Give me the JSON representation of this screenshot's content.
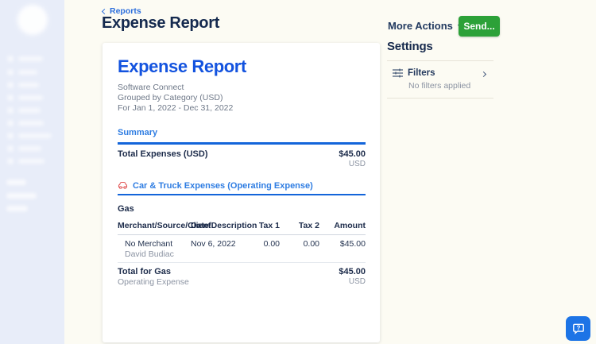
{
  "header": {
    "breadcrumb": "Reports",
    "title": "Expense Report",
    "more_actions_label": "More Actions",
    "send_label": "Send..."
  },
  "report": {
    "title": "Expense Report",
    "company": "Software Connect",
    "grouping": "Grouped by Category (USD)",
    "date_range": "For Jan 1, 2022 - Dec 31, 2022",
    "summary_link": "Summary",
    "total": {
      "label": "Total Expenses (USD)",
      "amount": "$45.00",
      "currency": "USD"
    },
    "category": {
      "icon": "car-icon",
      "label": "Car & Truck Expenses (Operating Expense)"
    },
    "subcategory": "Gas",
    "table": {
      "columns": [
        "Merchant/Source/Client",
        "Date/Description",
        "Tax 1",
        "Tax 2",
        "Amount"
      ],
      "rows": [
        {
          "merchant": "No Merchant",
          "submerchant": "David Budiac",
          "date": "Nov 6, 2022",
          "tax1": "0.00",
          "tax2": "0.00",
          "amount": "$45.00"
        }
      ],
      "total": {
        "label": "Total for Gas",
        "sublabel": "Operating Expense",
        "amount": "$45.00",
        "currency": "USD"
      }
    }
  },
  "settings": {
    "title": "Settings",
    "filters": {
      "label": "Filters",
      "status": "No filters applied"
    }
  },
  "colors": {
    "accent_blue": "#1353df",
    "link_blue": "#2f7de2",
    "rule_blue": "#1365da",
    "navy_text": "#1c2b4a",
    "green_button": "#2ca138",
    "car_red": "#e25c5c",
    "help_blue": "#1d74e6",
    "page_bg": "#fcfbf3",
    "sidebar_bg": "#e8edf9"
  }
}
